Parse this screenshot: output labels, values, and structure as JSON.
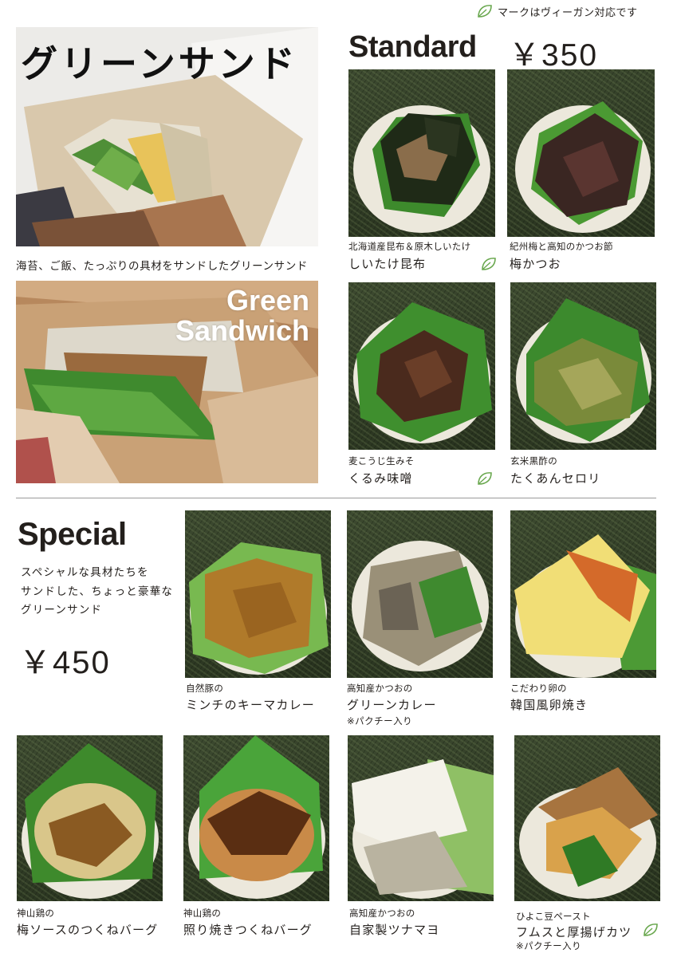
{
  "vegan_note": "マークはヴィーガン対応です",
  "hero": {
    "title_jp": "グリーンサンド",
    "tagline": "海苔、ご飯、たっぷりの具材をサンドしたグリーンサンド",
    "title_en": [
      "Green",
      "Sandwich"
    ]
  },
  "standard": {
    "title": "Standard",
    "price": "￥350",
    "items": [
      {
        "sub": "北海道産昆布＆原木しいたけ",
        "name": "しいたけ昆布",
        "vegan": true
      },
      {
        "sub": "紀州梅と高知のかつお節",
        "name": "梅かつお",
        "vegan": false
      },
      {
        "sub": "麦こうじ生みそ",
        "name": "くるみ味噌",
        "vegan": true
      },
      {
        "sub": "玄米黒酢の",
        "name": "たくあんセロリ",
        "vegan": false
      }
    ]
  },
  "special": {
    "title": "Special",
    "description": [
      "スペシャルな具材たちを",
      "サンドした、ちょっと豪華な",
      "グリーンサンド"
    ],
    "price": "￥450",
    "items": [
      {
        "sub": "自然豚の",
        "name": "ミンチのキーマカレー",
        "note": ""
      },
      {
        "sub": "高知産かつおの",
        "name": "グリーンカレー",
        "note": "※パクチー入り"
      },
      {
        "sub": "こだわり卵の",
        "name": "韓国風卵焼き",
        "note": ""
      },
      {
        "sub": "神山鶏の",
        "name": "梅ソースのつくねバーグ",
        "note": ""
      },
      {
        "sub": "神山鶏の",
        "name": "照り焼きつくねバーグ",
        "note": ""
      },
      {
        "sub": "高知産かつおの",
        "name": "自家製ツナマヨ",
        "note": ""
      },
      {
        "sub": "ひよこ豆ペースト",
        "name": "フムスと厚揚げカツ",
        "note": "※パクチー入り",
        "vegan": true
      }
    ]
  },
  "colors": {
    "accent_leaf": "#6aa84f",
    "text": "#231f1c",
    "divider": "#9a9a9a"
  }
}
